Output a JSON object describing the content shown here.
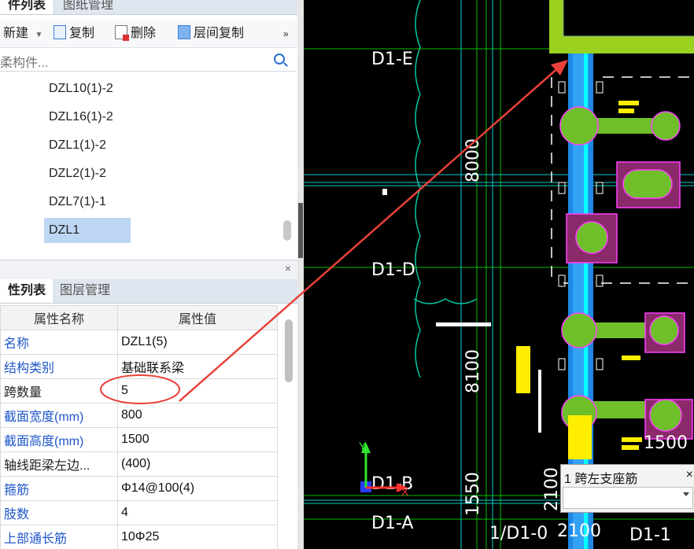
{
  "component_panel": {
    "tabs": [
      {
        "label": "件列表",
        "active": true
      },
      {
        "label": "图纸管理",
        "active": false
      }
    ],
    "toolbar": {
      "new_label": "新建",
      "copy_label": "复制",
      "delete_label": "删除",
      "floor_copy_label": "层间复制",
      "more_label": "»"
    },
    "search_placeholder": "柔构件...",
    "items": [
      {
        "label": "DZL10(1)-2",
        "selected": false
      },
      {
        "label": "DZL16(1)-2",
        "selected": false
      },
      {
        "label": "DZL1(1)-2",
        "selected": false
      },
      {
        "label": "DZL2(1)-2",
        "selected": false
      },
      {
        "label": "DZL7(1)-1",
        "selected": false
      },
      {
        "label": "DZL1",
        "selected": true
      }
    ]
  },
  "property_panel": {
    "close_label": "×",
    "tabs": [
      {
        "label": "性列表",
        "active": true
      },
      {
        "label": "图层管理",
        "active": false
      }
    ],
    "columns": [
      "属性名称",
      "属性值"
    ],
    "rows": [
      {
        "name": "名称",
        "value": "DZL1(5)",
        "highlight": true
      },
      {
        "name": "结构类别",
        "value": "基础联系梁",
        "highlight": true
      },
      {
        "name": "跨数量",
        "value": "5",
        "highlight": false
      },
      {
        "name": "截面宽度(mm)",
        "value": "800",
        "highlight": true
      },
      {
        "name": "截面高度(mm)",
        "value": "1500",
        "highlight": true
      },
      {
        "name": "轴线距梁左边...",
        "value": "(400)",
        "highlight": false
      },
      {
        "name": "箍筋",
        "value": "Φ14@100(4)",
        "highlight": true
      },
      {
        "name": "肢数",
        "value": "4",
        "highlight": true
      },
      {
        "name": "上部通长筋",
        "value": "10Φ25",
        "highlight": true
      }
    ]
  },
  "cad_view": {
    "axis_labels": [
      "D1-E",
      "D1-D",
      "D1-B",
      "D1-A",
      "1/D1-0",
      "D1-1"
    ],
    "dimensions": [
      "8000",
      "8100",
      "1550",
      "2100",
      "1500",
      "2100"
    ],
    "popup": {
      "title": "1 跨左支座筋",
      "close_label": "×"
    },
    "ucs": {
      "x_label": "X",
      "y_label": "Y"
    }
  },
  "annotation": {
    "color": "#e8413a"
  }
}
